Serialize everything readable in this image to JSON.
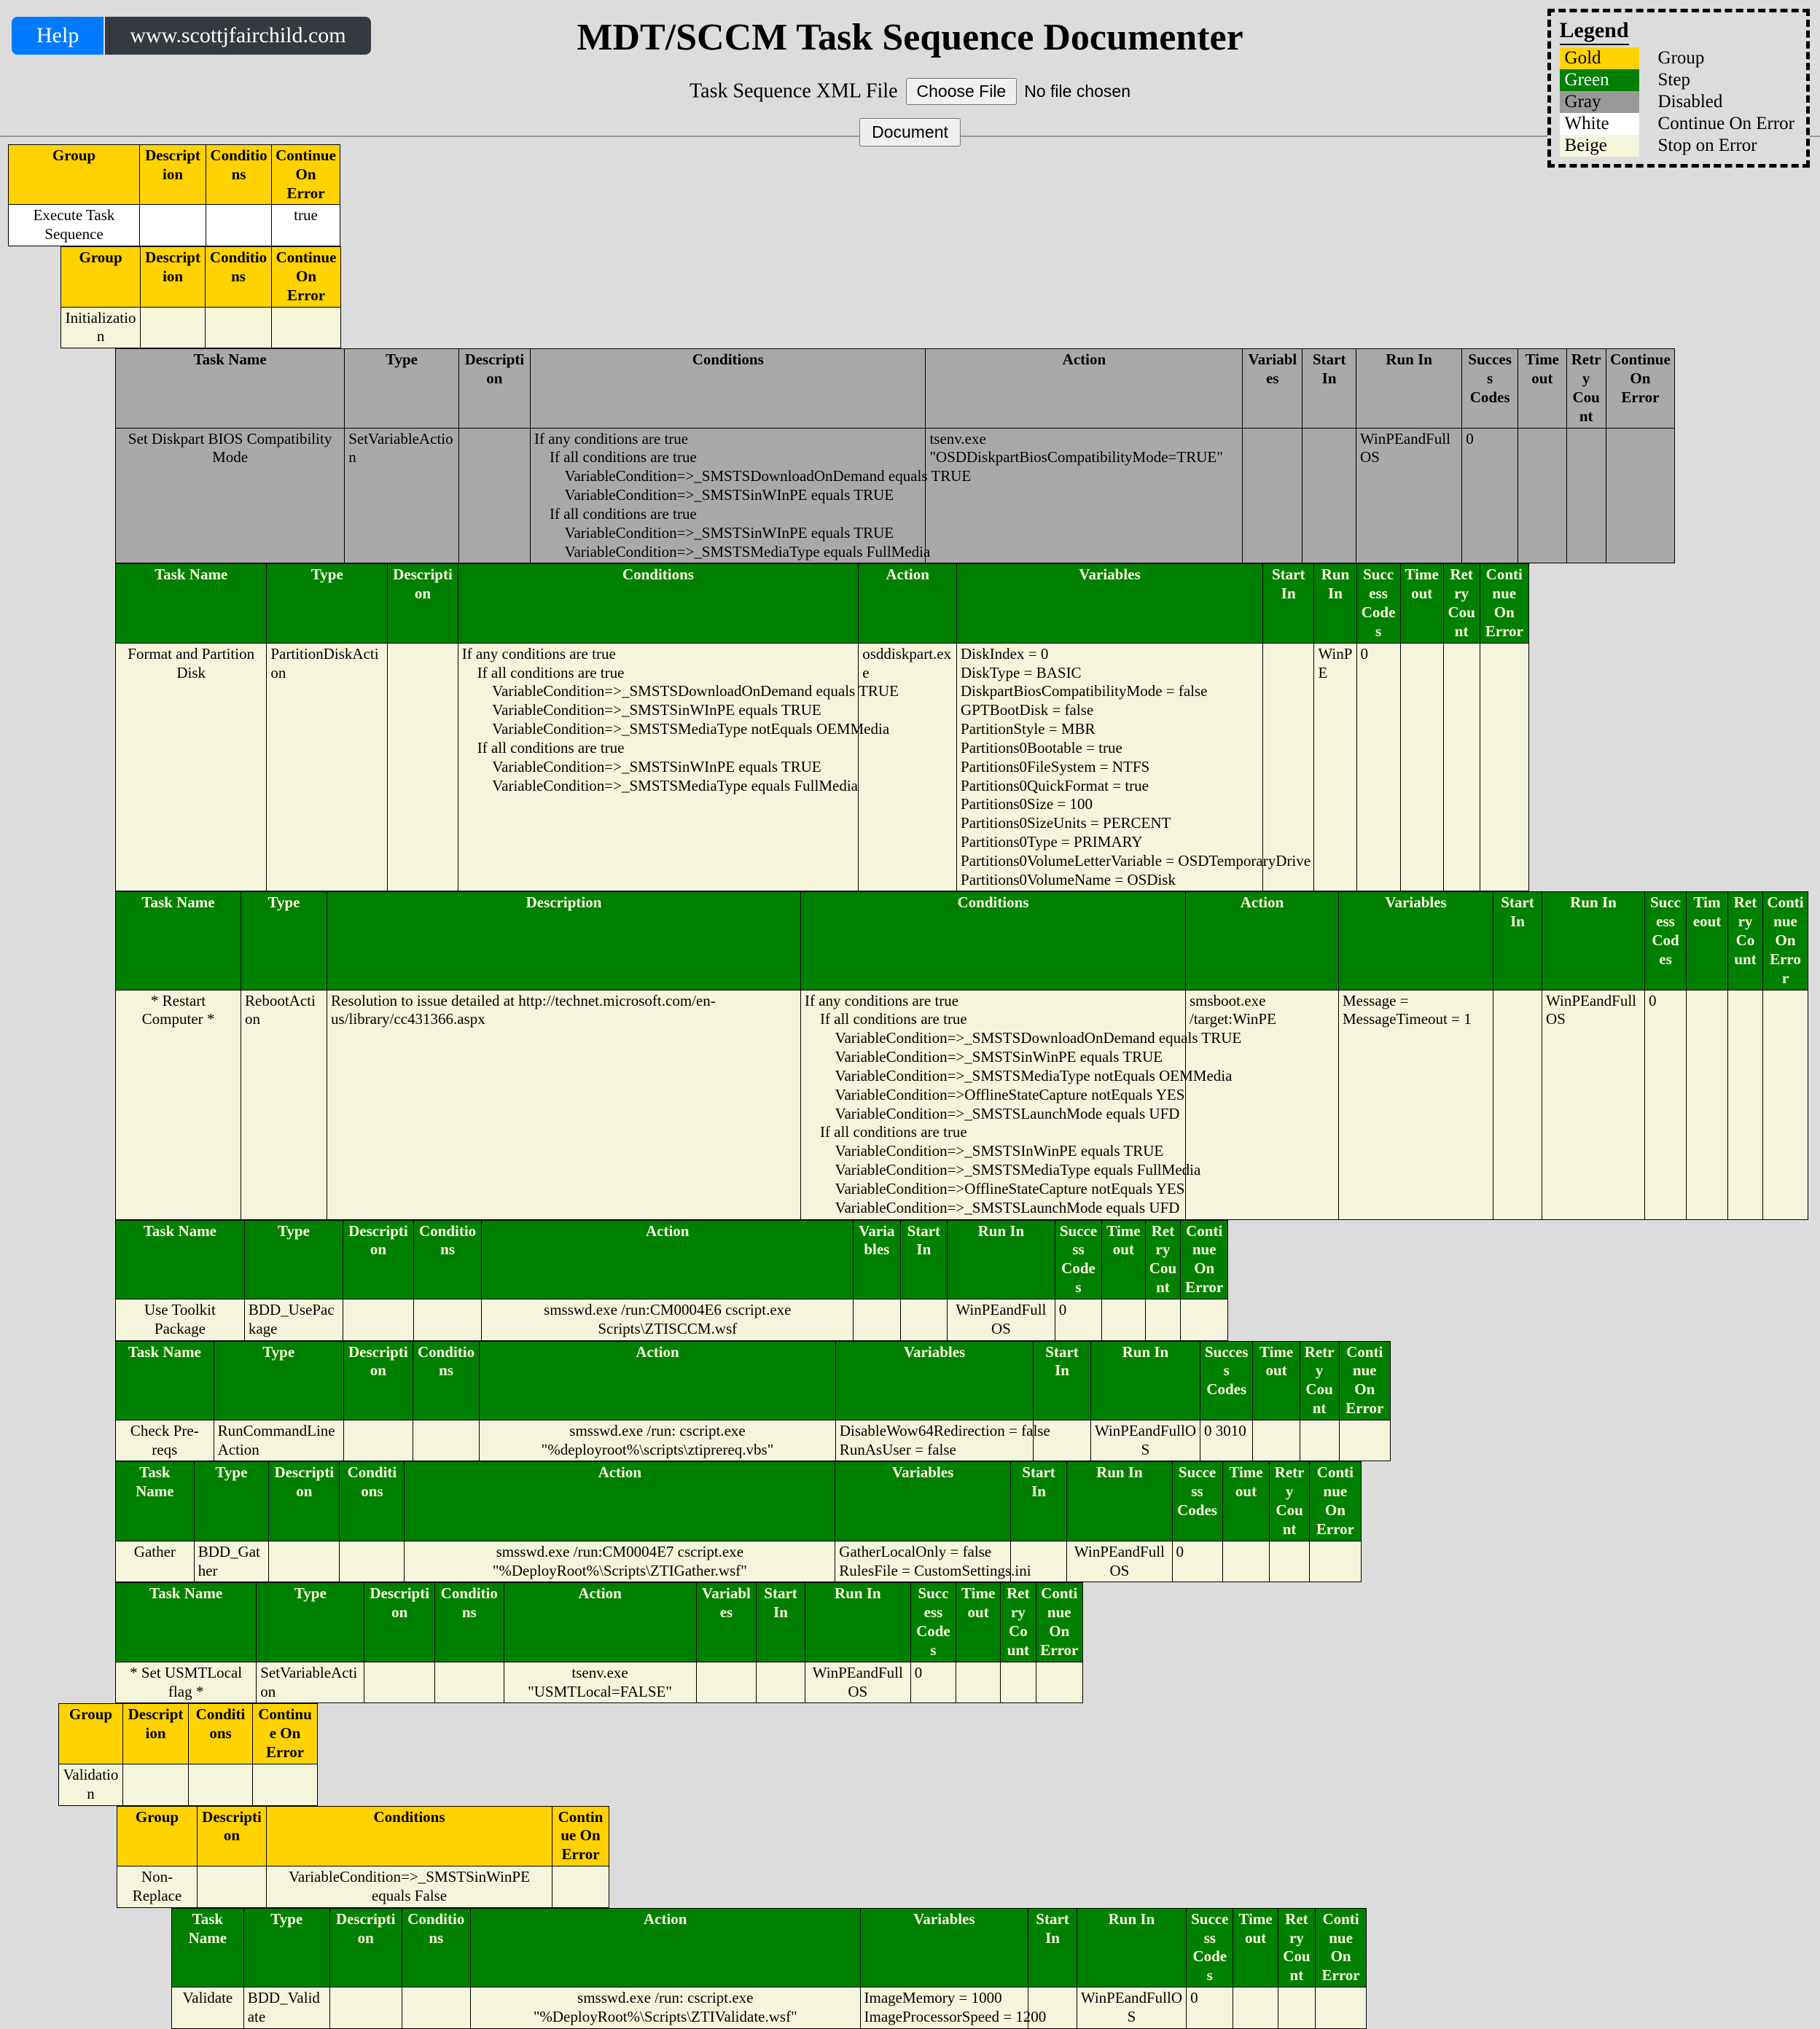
{
  "header": {
    "help_label": "Help",
    "site_label": "www.scottjfairchild.com",
    "title": "MDT/SCCM Task Sequence Documenter",
    "file_label": "Task Sequence XML File",
    "choose_file_label": "Choose File",
    "no_file_label": "No file chosen",
    "document_label": "Document"
  },
  "legend": {
    "title": "Legend",
    "rows": [
      {
        "swatch": "Gold",
        "desc": "Group"
      },
      {
        "swatch": "Green",
        "desc": "Step"
      },
      {
        "swatch": "Gray",
        "desc": "Disabled"
      },
      {
        "swatch": "White",
        "desc": "Continue On Error"
      },
      {
        "swatch": "Beige",
        "desc": "Stop on Error"
      }
    ],
    "colors": {
      "gold": "#ffd200",
      "green": "#008000",
      "gray": "#999999",
      "white": "#ffffff",
      "beige": "#f5f5dc"
    }
  },
  "group_headers": {
    "group": "Group",
    "description": "Description",
    "conditions": "Conditions",
    "continue_on_error": "Continue On Error"
  },
  "step_headers": {
    "task_name": "Task Name",
    "type": "Type",
    "description": "Description",
    "conditions": "Conditions",
    "action": "Action",
    "variables": "Variables",
    "start_in": "Start In",
    "run_in": "Run In",
    "success_codes": "Success Codes",
    "timeout": "Timeout",
    "retry_count": "Retry Count",
    "continue_on_error": "Continue On Error"
  },
  "groups": {
    "execute_task_sequence": {
      "name": "Execute Task Sequence",
      "description": "",
      "conditions": "",
      "continue_on_error": "true"
    },
    "initialization": {
      "name": "Initialization",
      "description": "",
      "conditions": "",
      "continue_on_error": ""
    },
    "validation": {
      "name": "Validation",
      "description": "",
      "conditions": "",
      "continue_on_error": ""
    },
    "non_replace": {
      "name": "Non-Replace",
      "description": "",
      "conditions": "VariableCondition=>_SMSTSinWinPE equals False",
      "continue_on_error": ""
    }
  },
  "steps": {
    "set_diskpart": {
      "task_name": "Set Diskpart BIOS Compatibility Mode",
      "type": "SetVariableAction",
      "description": "",
      "conditions": "If any conditions are true\n    If all conditions are true\n        VariableCondition=>_SMSTSDownloadOnDemand equals TRUE\n        VariableCondition=>_SMSTSinWInPE equals TRUE\n    If all conditions are true\n        VariableCondition=>_SMSTSinWInPE equals TRUE\n        VariableCondition=>_SMSTSMediaType equals FullMedia",
      "action": "tsenv.exe \"OSDDiskpartBiosCompatibilityMode=TRUE\"",
      "variables": "",
      "start_in": "",
      "run_in": "WinPEandFullOS",
      "success_codes": "0",
      "timeout": "",
      "retry_count": "",
      "continue_on_error": ""
    },
    "format_partition": {
      "task_name": "Format and Partition Disk",
      "type": "PartitionDiskAction",
      "description": "",
      "conditions": "If any conditions are true\n    If all conditions are true\n        VariableCondition=>_SMSTSDownloadOnDemand equals TRUE\n        VariableCondition=>_SMSTSinWInPE equals TRUE\n        VariableCondition=>_SMSTSMediaType notEquals OEMMedia\n    If all conditions are true\n        VariableCondition=>_SMSTSinWInPE equals TRUE\n        VariableCondition=>_SMSTSMediaType equals FullMedia",
      "action": "osddiskpart.exe",
      "variables": "DiskIndex = 0\nDiskType = BASIC\nDiskpartBiosCompatibilityMode = false\nGPTBootDisk = false\nPartitionStyle = MBR\nPartitions0Bootable = true\nPartitions0FileSystem = NTFS\nPartitions0QuickFormat = true\nPartitions0Size = 100\nPartitions0SizeUnits = PERCENT\nPartitions0Type = PRIMARY\nPartitions0VolumeLetterVariable = OSDTemporaryDrive\nPartitions0VolumeName = OSDisk",
      "start_in": "",
      "run_in": "WinPE",
      "success_codes": "0",
      "timeout": "",
      "retry_count": "",
      "continue_on_error": ""
    },
    "restart_computer": {
      "task_name": "* Restart Computer *",
      "type": "RebootAction",
      "description": "Resolution to issue detailed at http://technet.microsoft.com/en-us/library/cc431366.aspx",
      "conditions": "If any conditions are true\n    If all conditions are true\n        VariableCondition=>_SMSTSDownloadOnDemand equals TRUE\n        VariableCondition=>_SMSTSinWinPE equals TRUE\n        VariableCondition=>_SMSTSMediaType notEquals OEMMedia\n        VariableCondition=>OfflineStateCapture notEquals YES\n        VariableCondition=>_SMSTSLaunchMode equals UFD\n    If all conditions are true\n        VariableCondition=>_SMSTSInWinPE equals TRUE\n        VariableCondition=>_SMSTSMediaType equals FullMedia\n        VariableCondition=>OfflineStateCapture notEquals YES\n        VariableCondition=>_SMSTSLaunchMode equals UFD",
      "action": "smsboot.exe /target:WinPE",
      "variables": "Message = \nMessageTimeout = 1",
      "start_in": "",
      "run_in": "WinPEandFullOS",
      "success_codes": "0",
      "timeout": "",
      "retry_count": "",
      "continue_on_error": ""
    },
    "use_toolkit_package": {
      "task_name": "Use Toolkit Package",
      "type": "BDD_UsePackage",
      "description": "",
      "conditions": "",
      "action": "smsswd.exe /run:CM0004E6 cscript.exe Scripts\\ZTISCCM.wsf",
      "variables": "",
      "start_in": "",
      "run_in": "WinPEandFullOS",
      "success_codes": "0",
      "timeout": "",
      "retry_count": "",
      "continue_on_error": ""
    },
    "check_prereqs": {
      "task_name": "Check Pre-reqs",
      "type": "RunCommandLineAction",
      "description": "",
      "conditions": "",
      "action": "smsswd.exe /run: cscript.exe \"%deployroot%\\scripts\\ztiprereq.vbs\"",
      "variables": "DisableWow64Redirection = false\nRunAsUser = false",
      "start_in": "",
      "run_in": "WinPEandFullOS",
      "success_codes": "0 3010",
      "timeout": "",
      "retry_count": "",
      "continue_on_error": ""
    },
    "gather": {
      "task_name": "Gather",
      "type": "BDD_Gather",
      "description": "",
      "conditions": "",
      "action": "smsswd.exe /run:CM0004E7 cscript.exe \"%DeployRoot%\\Scripts\\ZTIGather.wsf\"",
      "variables": "GatherLocalOnly = false\nRulesFile = CustomSettings.ini",
      "start_in": "",
      "run_in": "WinPEandFullOS",
      "success_codes": "0",
      "timeout": "",
      "retry_count": "",
      "continue_on_error": ""
    },
    "set_usmtlocal": {
      "task_name": "* Set USMTLocal flag *",
      "type": "SetVariableAction",
      "description": "",
      "conditions": "",
      "action": "tsenv.exe \"USMTLocal=FALSE\"",
      "variables": "",
      "start_in": "",
      "run_in": "WinPEandFullOS",
      "success_codes": "0",
      "timeout": "",
      "retry_count": "",
      "continue_on_error": ""
    },
    "validate": {
      "task_name": "Validate",
      "type": "BDD_Validate",
      "description": "",
      "conditions": "",
      "action": "smsswd.exe /run: cscript.exe \"%DeployRoot%\\Scripts\\ZTIValidate.wsf\"",
      "variables": "ImageMemory = 1000\nImageProcessorSpeed = 1200",
      "start_in": "",
      "run_in": "WinPEandFullOS",
      "success_codes": "0",
      "timeout": "",
      "retry_count": "",
      "continue_on_error": ""
    }
  }
}
